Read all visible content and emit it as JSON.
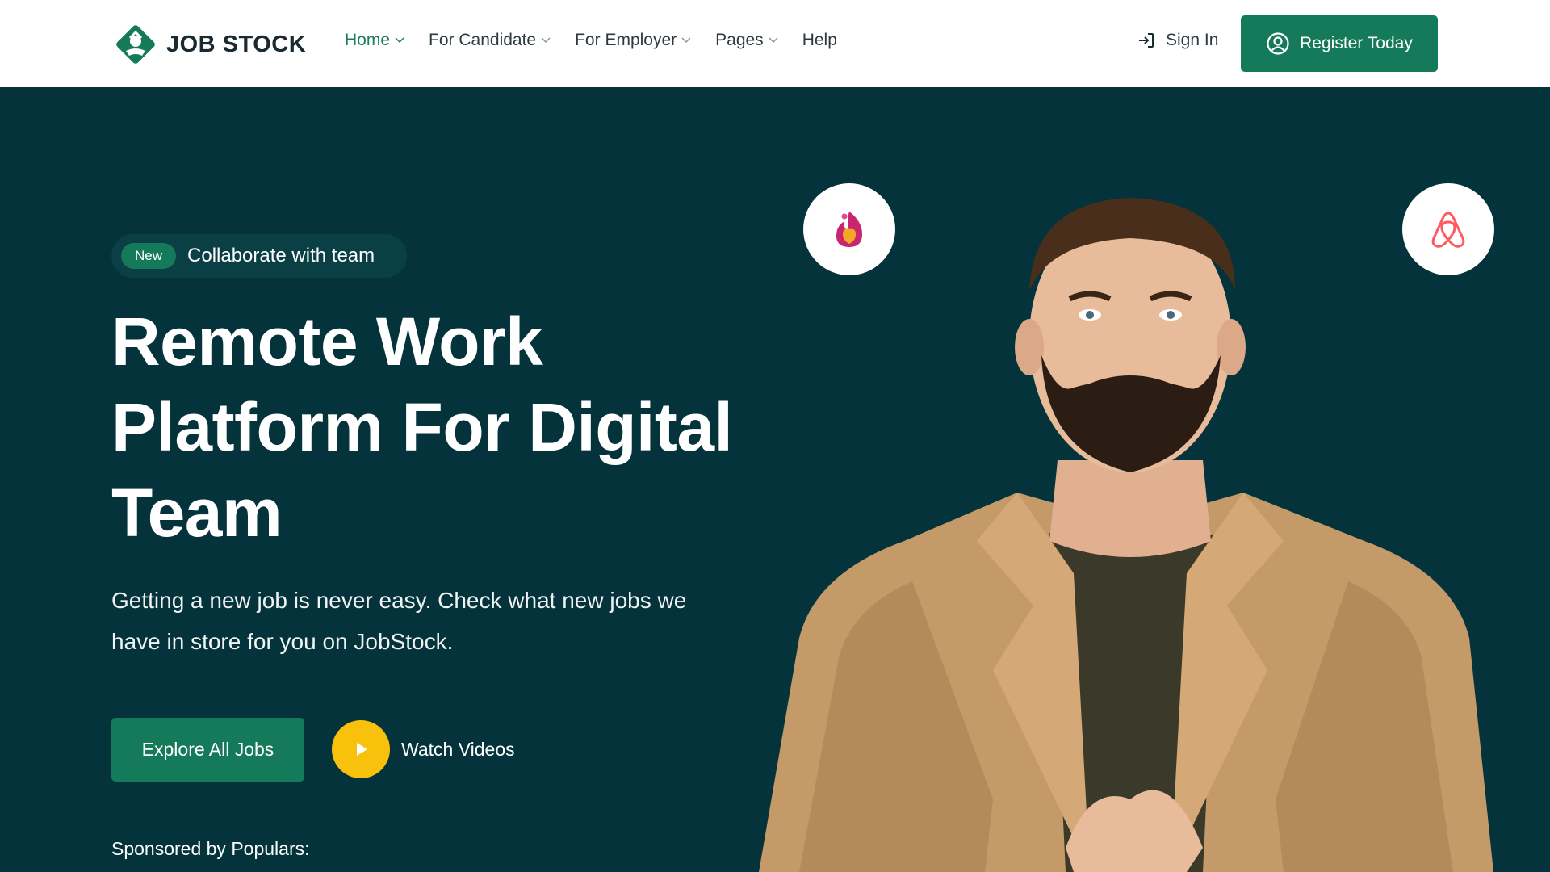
{
  "brand": {
    "name": "JOB STOCK",
    "color": "#157a5a"
  },
  "nav": {
    "items": [
      {
        "label": "Home",
        "has_dropdown": true,
        "active": true
      },
      {
        "label": "For Candidate",
        "has_dropdown": true,
        "active": false
      },
      {
        "label": "For Employer",
        "has_dropdown": true,
        "active": false
      },
      {
        "label": "Pages",
        "has_dropdown": true,
        "active": false
      },
      {
        "label": "Help",
        "has_dropdown": false,
        "active": false
      }
    ],
    "signin_label": "Sign In",
    "register_label": "Register Today"
  },
  "hero": {
    "badge_new": "New",
    "badge_text": "Collaborate with team",
    "title_line1": "Remote Work",
    "title_line2": "Platform For Digital",
    "title_line3": "Team",
    "subtitle_line1": "Getting a new job is never easy. Check what new jobs we",
    "subtitle_line2": "have in store for you on JobStock.",
    "explore_label": "Explore All Jobs",
    "watch_label": "Watch Videos",
    "sponsored_label": "Sponsored by Populars:"
  },
  "icons": {
    "logo": "job-stock-logo-icon",
    "signin": "sign-in-arrow-icon",
    "register": "user-circle-icon",
    "play": "play-icon",
    "float_left": "flame-heart-logo-icon",
    "float_right": "airbnb-logo-icon"
  },
  "colors": {
    "hero_bg": "#04333b",
    "accent_green": "#157a5a",
    "play_yellow": "#f8c20c",
    "airbnb_red": "#ff5a5f"
  }
}
